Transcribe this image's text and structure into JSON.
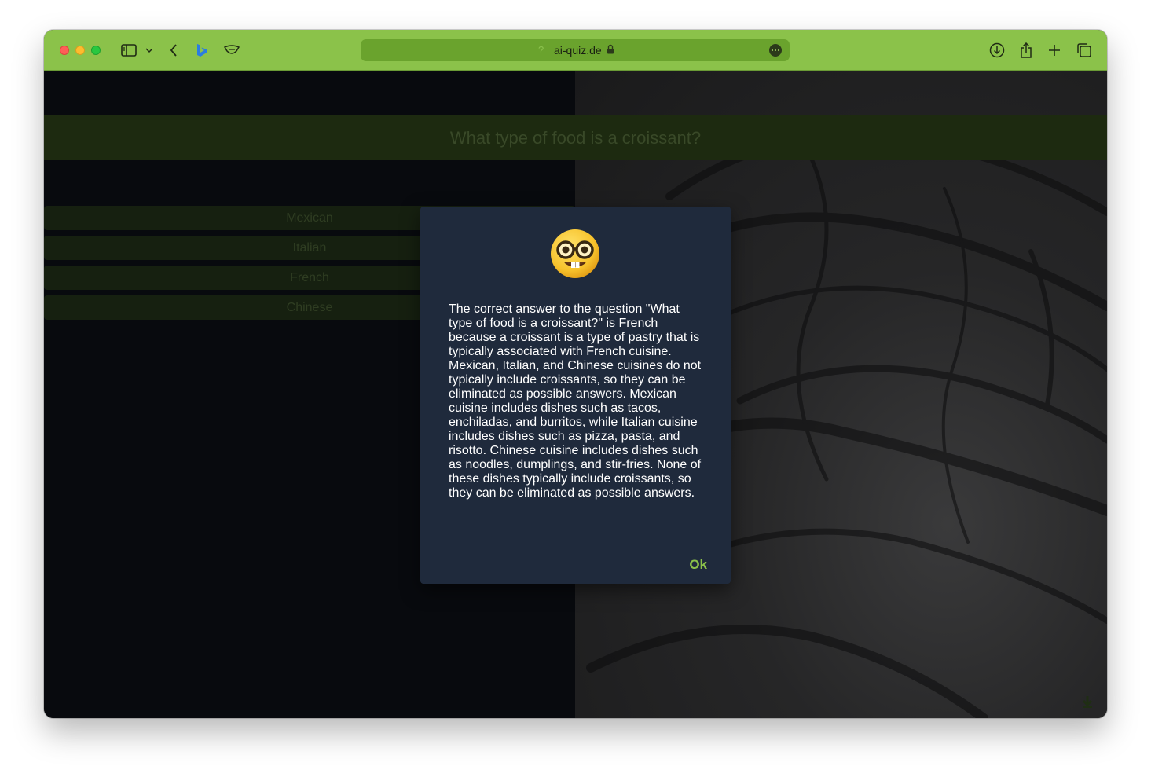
{
  "browser": {
    "address": {
      "host": "ai-quiz.de",
      "prefix_glyph": "?"
    },
    "toolbar_icons": [
      "sidebar-icon",
      "chevron-down-icon",
      "back-icon",
      "bing-icon",
      "shield-icon",
      "download-icon",
      "share-icon",
      "new-tab-icon",
      "tabs-overview-icon"
    ],
    "accent_color": "#8bc24a"
  },
  "quiz": {
    "question": "What type of food is a croissant?",
    "answers": [
      "Mexican",
      "Italian",
      "French",
      "Chinese"
    ]
  },
  "modal": {
    "emoji": "nerd-face",
    "explanation": "The correct answer to the question \"What type of food is a croissant?\" is French because a croissant is a type of pastry that is typically associated with French cuisine. Mexican, Italian, and Chinese cuisines do not typically include croissants, so they can be eliminated as possible answers. Mexican cuisine includes dishes such as tacos, enchiladas, and burritos, while Italian cuisine includes dishes such as pizza, pasta, and risotto. Chinese cuisine includes dishes such as noodles, dumplings, and stir-fries. None of these dishes typically include croissants, so they can be eliminated as possible answers.",
    "ok_label": "Ok"
  }
}
